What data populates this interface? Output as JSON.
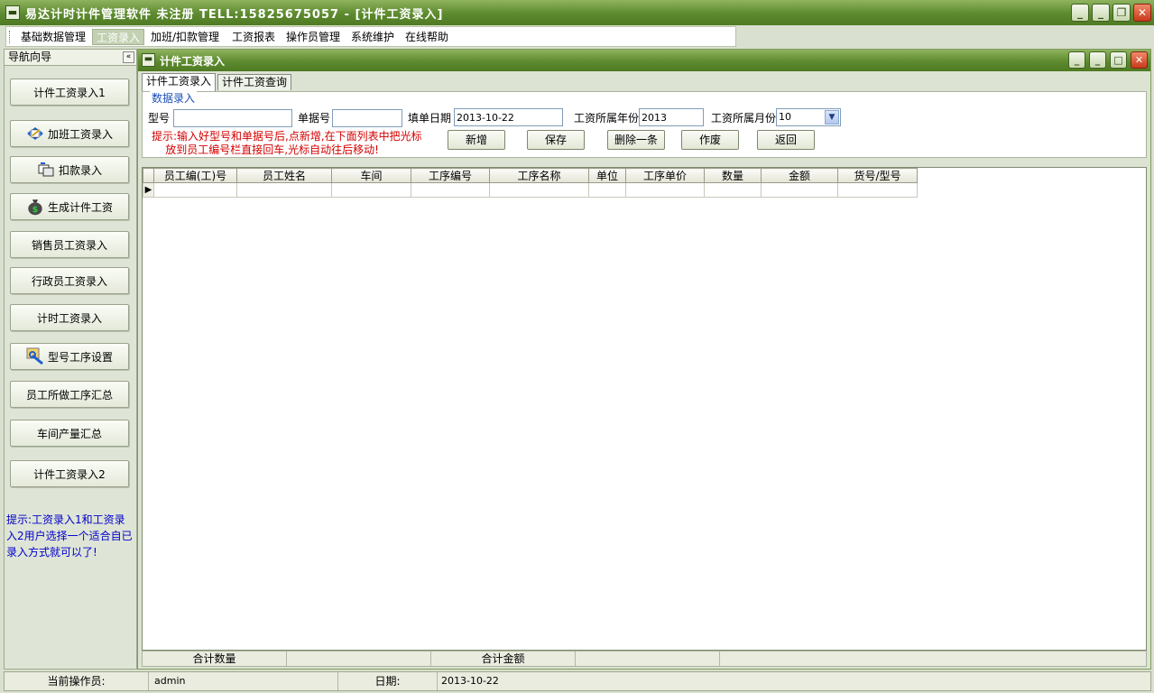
{
  "window": {
    "title": "易达计时计件管理软件 未注册 TELL:15825675057 - [计件工资录入]",
    "min": "_",
    "max": "❐",
    "close": "✕"
  },
  "menu": [
    "基础数据管理",
    "工资录入",
    "加班/扣款管理",
    "工资报表",
    "操作员管理",
    "系统维护",
    "在线帮助"
  ],
  "nav": {
    "title": "导航向导",
    "collapse": "«",
    "items": [
      "计件工资录入1",
      "加班工资录入",
      "扣款录入",
      "生成计件工资",
      "销售员工资录入",
      "行政员工资录入",
      "计时工资录入",
      "型号工序设置",
      "员工所做工序汇总",
      "车间产量汇总",
      "计件工资录入2"
    ],
    "tip": "提示:工资录入1和工资录入2用户选择一个适合自已录入方式就可以了!"
  },
  "inner": {
    "title": "计件工资录入",
    "tabs": [
      "计件工资录入",
      "计件工资查询"
    ]
  },
  "form": {
    "legend": "数据录入",
    "model_label": "型号",
    "model_value": "",
    "doc_label": "单据号",
    "doc_value": "",
    "date_label": "填单日期",
    "date_value": "2013-10-22",
    "year_label": "工资所属年份",
    "year_value": "2013",
    "month_label": "工资所属月份",
    "month_value": "10",
    "hint": "提示:输入好型号和单据号后,点新增,在下面列表中把光标\n    放到员工编号栏直接回车,光标自动往后移动!",
    "buttons": {
      "add": "新增",
      "save": "保存",
      "delete": "删除一条",
      "void": "作废",
      "back": "返回"
    }
  },
  "grid": {
    "columns": [
      "员工编(工)号",
      "员工姓名",
      "车间",
      "工序编号",
      "工序名称",
      "单位",
      "工序单价",
      "数量",
      "金额",
      "货号/型号"
    ],
    "row_indicator": "▶"
  },
  "summary": {
    "qty_label": "合计数量",
    "amount_label": "合计金额"
  },
  "status": {
    "operator_label": "当前操作员:",
    "operator": "admin",
    "date_label": "日期:",
    "date": "2013-10-22"
  }
}
